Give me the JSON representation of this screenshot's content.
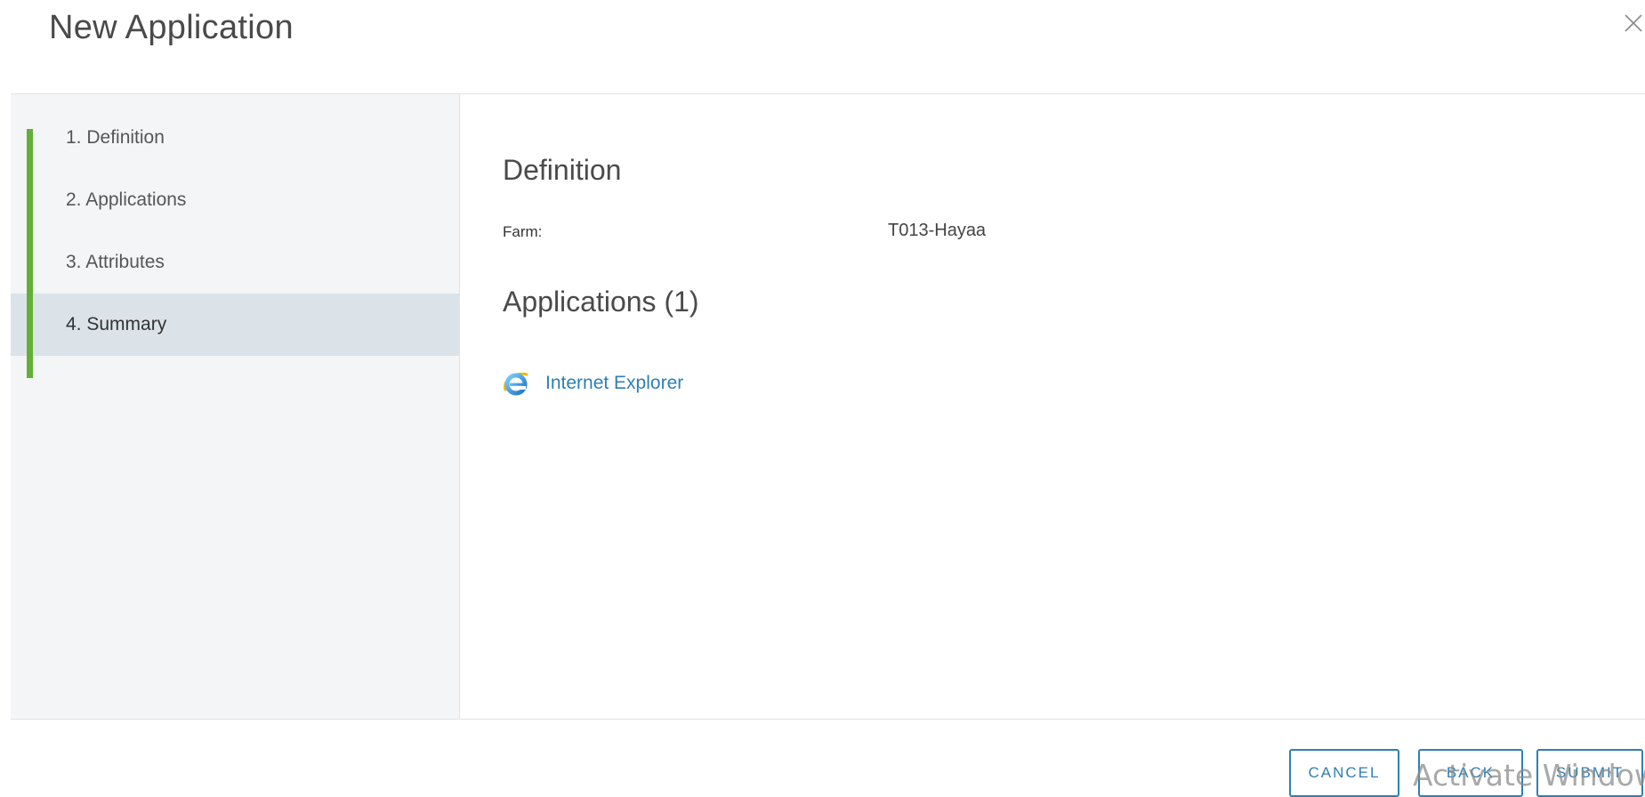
{
  "dialog": {
    "title": "New Application",
    "close_icon": "close-icon"
  },
  "wizard": {
    "steps": [
      {
        "label": "1. Definition",
        "active": false
      },
      {
        "label": "2. Applications",
        "active": false
      },
      {
        "label": "3. Attributes",
        "active": false
      },
      {
        "label": "4. Summary",
        "active": true
      }
    ],
    "progress_color": "#62b036"
  },
  "summary": {
    "definition_heading": "Definition",
    "farm_label": "Farm:",
    "farm_value": "T013-Hayaa",
    "applications_heading": "Applications (1)",
    "applications": [
      {
        "name": "Internet Explorer",
        "icon": "internet-explorer-icon"
      }
    ]
  },
  "footer": {
    "cancel_label": "CANCEL",
    "back_label": "BACK",
    "submit_label": "SUBMIT"
  },
  "watermark": {
    "text": "Activate Windows"
  },
  "colors": {
    "accent": "#2f7fb5",
    "sidebar_bg": "#f4f5f6",
    "active_step_bg": "#dbe3e9"
  }
}
